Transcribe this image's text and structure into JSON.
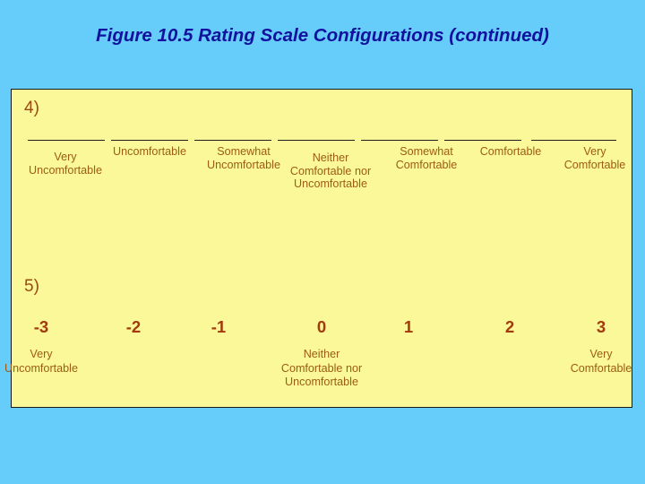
{
  "slide": {
    "title": "Figure 10.5  Rating Scale Configurations (continued)",
    "background_color": "#66ccfa",
    "panel_color": "#fbf89a",
    "title_color": "#11119e",
    "label_color": "#9c5c12",
    "number_color": "#a33a0c"
  },
  "items": {
    "item4": {
      "number": "4)",
      "type": "labeled-line-scale",
      "line_count": 7,
      "labels": [
        "Very\nUncomfortable",
        "Uncomfortable",
        "Somewhat\nUncomfortable",
        "Neither\nComfortable nor\nUncomfortable",
        "Somewhat\nComfortable",
        "Comfortable",
        "Very\nComfortable"
      ]
    },
    "item5": {
      "number": "5)",
      "type": "numeric-scale",
      "numbers": [
        "-3",
        "-2",
        "-1",
        "0",
        "1",
        "2",
        "3"
      ],
      "labels": [
        "Very\nUncomfortable",
        "",
        "",
        "Neither\nComfortable nor\nUncomfortable",
        "",
        "",
        "Very\nComfortable"
      ]
    }
  }
}
